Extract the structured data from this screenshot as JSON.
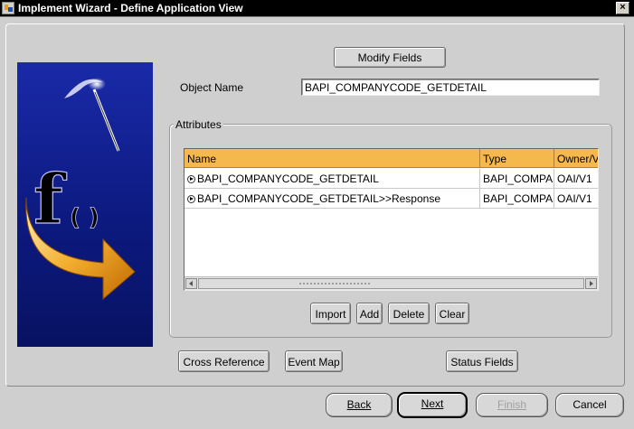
{
  "window": {
    "title": "Implement Wizard - Define Application View",
    "close_label": "×"
  },
  "top": {
    "modify_fields_label": "Modify Fields",
    "object_name_label": "Object Name",
    "object_name_value": "BAPI_COMPANYCODE_GETDETAIL"
  },
  "attributes": {
    "group_label": "Attributes",
    "columns": [
      "Name",
      "Type",
      "Owner/V"
    ],
    "rows": [
      {
        "name": "BAPI_COMPANYCODE_GETDETAIL",
        "type": "BAPI_COMPAN",
        "owner": "OAI/V1"
      },
      {
        "name": "BAPI_COMPANYCODE_GETDETAIL>>Response",
        "type": "BAPI_COMPAN",
        "owner": "OAI/V1"
      }
    ],
    "buttons": {
      "import": "Import",
      "add": "Add",
      "delete": "Delete",
      "clear": "Clear"
    }
  },
  "lower_buttons": {
    "cross_reference": "Cross Reference",
    "event_map": "Event Map",
    "status_fields": "Status Fields"
  },
  "nav": {
    "back": "Back",
    "next": "Next",
    "finish": "Finish",
    "cancel": "Cancel"
  },
  "banner": {
    "icon": "function-f-icon",
    "glyph": "f",
    "parens": "( )"
  },
  "colors": {
    "table_header": "#f5b84c",
    "banner_blue": "#1a2aa8",
    "arrow_orange": "#f0a020"
  }
}
